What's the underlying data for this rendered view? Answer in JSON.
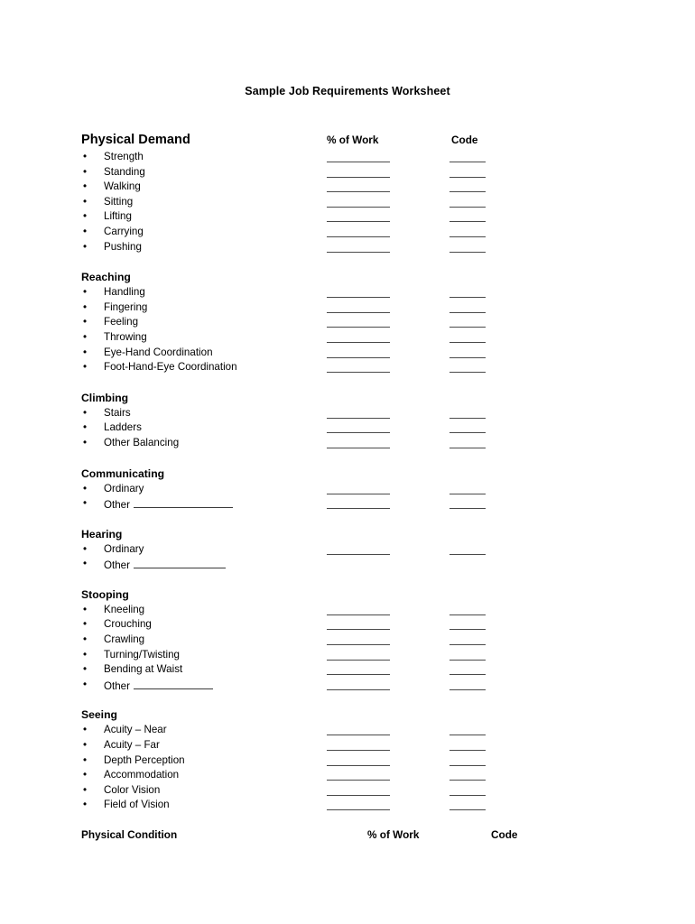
{
  "document": {
    "title": "Sample Job Requirements Worksheet"
  },
  "columns": {
    "percent_label": "% of Work",
    "code_label": "Code"
  },
  "sections": [
    {
      "heading": "Physical Demand",
      "heading_size": "big",
      "items": [
        {
          "label": "Strength",
          "rules": true
        },
        {
          "label": "Standing",
          "rules": true
        },
        {
          "label": "Walking",
          "rules": true
        },
        {
          "label": "Sitting",
          "rules": true
        },
        {
          "label": "Lifting",
          "rules": true
        },
        {
          "label": "Carrying",
          "rules": true
        },
        {
          "label": "Pushing",
          "rules": true
        }
      ]
    },
    {
      "heading": "Reaching",
      "heading_size": "normal",
      "items": [
        {
          "label": "Handling",
          "rules": true
        },
        {
          "label": "Fingering",
          "rules": true
        },
        {
          "label": "Feeling",
          "rules": true
        },
        {
          "label": "Throwing",
          "rules": true
        },
        {
          "label": "Eye-Hand Coordination",
          "rules": true
        },
        {
          "label": "Foot-Hand-Eye Coordination",
          "rules": true
        }
      ]
    },
    {
      "heading": "Climbing",
      "heading_size": "normal",
      "items": [
        {
          "label": "Stairs",
          "rules": true
        },
        {
          "label": "Ladders",
          "rules": true
        },
        {
          "label": "Other Balancing",
          "rules": true
        }
      ]
    },
    {
      "heading": "Communicating",
      "heading_size": "normal",
      "items": [
        {
          "label": "Ordinary",
          "rules": true
        },
        {
          "label": "Other",
          "rules": true,
          "blank_width": 110
        }
      ]
    },
    {
      "heading": "Hearing",
      "heading_size": "normal",
      "items": [
        {
          "label": "Ordinary",
          "rules": true
        },
        {
          "label": "Other",
          "rules": false,
          "blank_width": 102
        }
      ]
    },
    {
      "heading": "Stooping",
      "heading_size": "normal",
      "items": [
        {
          "label": "Kneeling",
          "rules": true
        },
        {
          "label": "Crouching",
          "rules": true
        },
        {
          "label": "Crawling",
          "rules": true
        },
        {
          "label": "Turning/Twisting",
          "rules": true
        },
        {
          "label": "Bending at Waist",
          "rules": true
        },
        {
          "label": "Other",
          "rules": true,
          "blank_width": 88
        }
      ]
    },
    {
      "heading": "Seeing",
      "heading_size": "normal",
      "items": [
        {
          "label": "Acuity – Near",
          "rules": true
        },
        {
          "label": "Acuity – Far",
          "rules": true
        },
        {
          "label": "Depth Perception",
          "rules": true
        },
        {
          "label": "Accommodation",
          "rules": true
        },
        {
          "label": "Color Vision",
          "rules": true
        },
        {
          "label": "Field of Vision",
          "rules": true
        }
      ]
    }
  ],
  "footer": {
    "label": "Physical Condition",
    "percent_label": "% of Work",
    "code_label": "Code"
  },
  "bullet_glyph": "•"
}
